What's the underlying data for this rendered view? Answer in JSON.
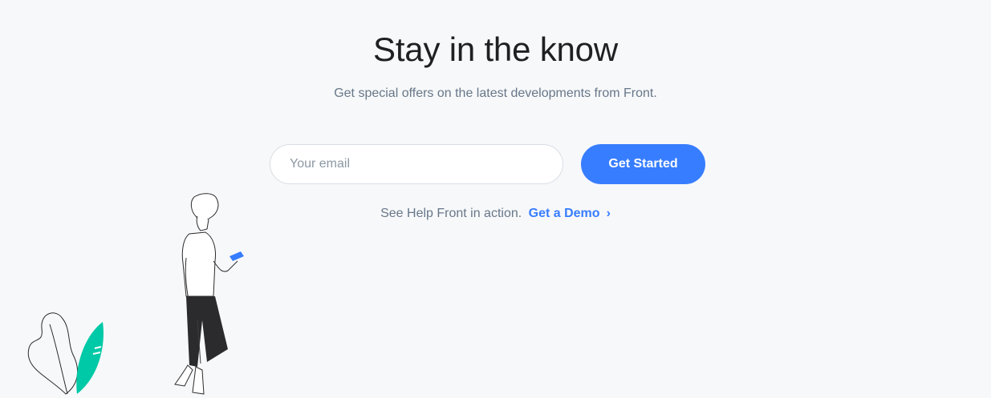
{
  "subscribe": {
    "title": "Stay in the know",
    "subtitle": "Get special offers on the latest developments from Front.",
    "email_placeholder": "Your email",
    "submit_label": "Get Started",
    "demo_prompt": "See Help Front in action.",
    "demo_link_label": "Get a Demo"
  },
  "icons": {
    "demo_link_icon": "chevron-right-icon",
    "illustration": "person-with-phone-illustration",
    "plant": "plant-leaves-illustration"
  },
  "colors": {
    "background": "#f7f8fa",
    "title": "#1e2022",
    "muted_text": "#677788",
    "accent": "#377dff",
    "leaf": "#00c9a7"
  }
}
